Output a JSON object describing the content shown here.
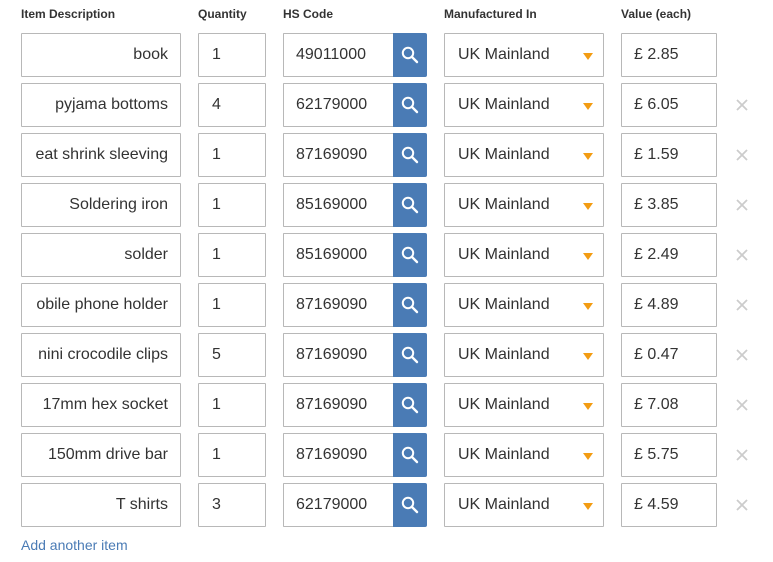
{
  "headers": {
    "description": "Item Description",
    "quantity": "Quantity",
    "hs_code": "HS Code",
    "manufactured_in": "Manufactured In",
    "value_each": "Value (each)"
  },
  "colors": {
    "search_button": "#4a7bb5",
    "dropdown_caret": "#f39c12",
    "link": "#4a7bb5",
    "remove_icon": "#cccccc"
  },
  "icons": {
    "search": "search-icon",
    "dropdown": "caret-down-icon",
    "remove": "close-icon"
  },
  "items": [
    {
      "description": "book",
      "quantity": "1",
      "hs_code": "49011000",
      "origin": "UK Mainland",
      "value": "£ 2.85",
      "removable": false
    },
    {
      "description": "pyjama bottoms",
      "quantity": "4",
      "hs_code": "62179000",
      "origin": "UK Mainland",
      "value": "£ 6.05",
      "removable": true
    },
    {
      "description": "eat shrink sleeving",
      "quantity": "1",
      "hs_code": "87169090",
      "origin": "UK Mainland",
      "value": "£ 1.59",
      "removable": true
    },
    {
      "description": "Soldering iron",
      "quantity": "1",
      "hs_code": "85169000",
      "origin": "UK Mainland",
      "value": "£ 3.85",
      "removable": true
    },
    {
      "description": "solder",
      "quantity": "1",
      "hs_code": "85169000",
      "origin": "UK Mainland",
      "value": "£ 2.49",
      "removable": true
    },
    {
      "description": "obile phone holder",
      "quantity": "1",
      "hs_code": "87169090",
      "origin": "UK Mainland",
      "value": "£ 4.89",
      "removable": true
    },
    {
      "description": "nini crocodile clips",
      "quantity": "5",
      "hs_code": "87169090",
      "origin": "UK Mainland",
      "value": "£ 0.47",
      "removable": true
    },
    {
      "description": "17mm hex socket",
      "quantity": "1",
      "hs_code": "87169090",
      "origin": "UK Mainland",
      "value": "£ 7.08",
      "removable": true
    },
    {
      "description": "150mm drive bar",
      "quantity": "1",
      "hs_code": "87169090",
      "origin": "UK Mainland",
      "value": "£ 5.75",
      "removable": true
    },
    {
      "description": "T shirts",
      "quantity": "3",
      "hs_code": "62179000",
      "origin": "UK Mainland",
      "value": "£ 4.59",
      "removable": true
    }
  ],
  "add_item_label": "Add another item"
}
